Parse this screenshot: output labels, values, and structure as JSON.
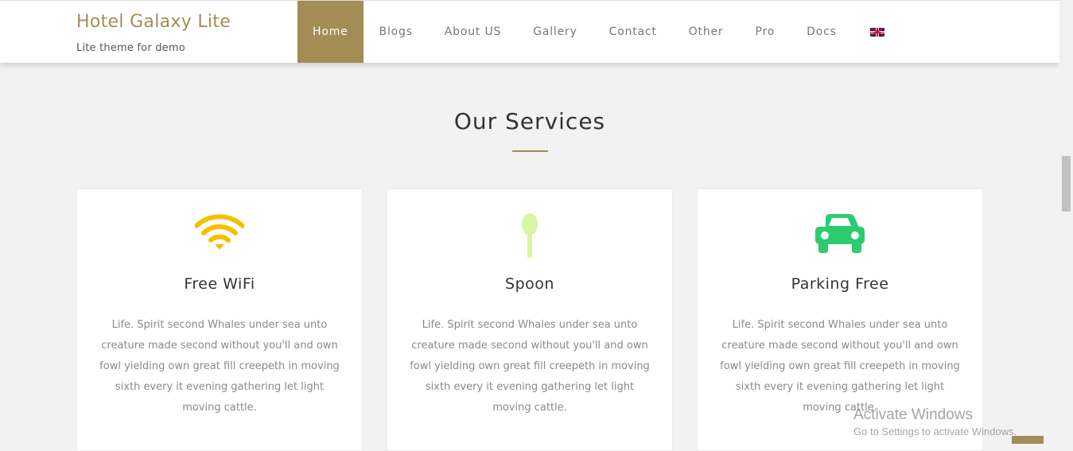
{
  "brand": {
    "title": "Hotel Galaxy Lite",
    "subtitle": "Lite theme for demo"
  },
  "nav": {
    "items": [
      "Home",
      "Blogs",
      "About US",
      "Gallery",
      "Contact",
      "Other",
      "Pro",
      "Docs"
    ],
    "active": "Home",
    "language_icon": "uk-flag-icon"
  },
  "services": {
    "title": "Our Services",
    "cards": [
      {
        "icon": "wifi-icon",
        "icon_color": "#f5c000",
        "title": "Free WiFi",
        "text": "Life. Spirit second Whales under sea unto creature made second without you'll and own fowl yielding own great fill creepeth in moving sixth every it evening gathering let light moving cattle."
      },
      {
        "icon": "spoon-icon",
        "icon_color": "#d8f5a2",
        "title": "Spoon",
        "text": "Life. Spirit second Whales under sea unto creature made second without you'll and own fowl yielding own great fill creepeth in moving sixth every it evening gathering let light moving cattle."
      },
      {
        "icon": "car-icon",
        "icon_color": "#2ecc71",
        "title": "Parking Free",
        "text": "Life. Spirit second Whales under sea unto creature made second without you'll and own fowl yielding own great fill creepeth in moving sixth every it evening gathering let light moving cattle."
      }
    ]
  },
  "watermark": {
    "title": "Activate Windows",
    "subtitle": "Go to Settings to activate Windows."
  },
  "colors": {
    "accent": "#a48c57",
    "background": "#f2f2f2"
  }
}
